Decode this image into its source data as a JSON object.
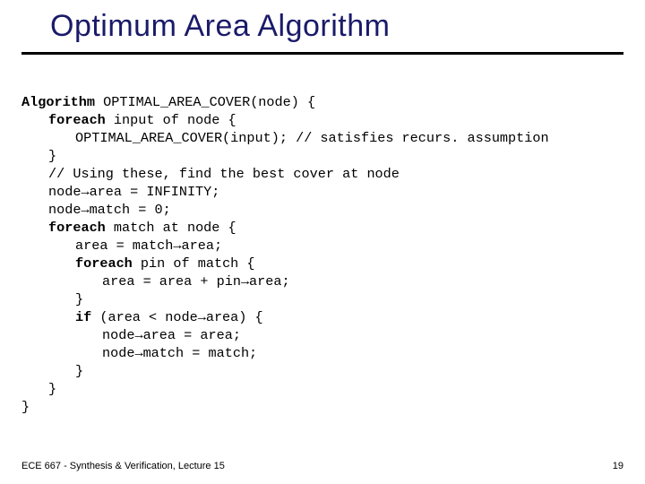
{
  "title": "Optimum Area Algorithm",
  "code": {
    "l1a": "Algorithm",
    "l1b": " OPTIMAL_AREA_COVER(node) {",
    "l2a": "foreach",
    "l2b": " input of node {",
    "l3": "OPTIMAL_AREA_COVER(input); // satisfies recurs. assumption",
    "l4": "}",
    "l5": "// Using these, find the best cover at node",
    "l6": "node→area = INFINITY;",
    "l7": "node→match = 0;",
    "l8a": "foreach",
    "l8b": " match at node {",
    "l9": "area = match→area;",
    "l10a": "foreach",
    "l10b": " pin of match {",
    "l11": "area = area + pin→area;",
    "l12": "}",
    "l13a": "if",
    "l13b": " (area < node→area) {",
    "l14": "node→area = area;",
    "l15": "node→match = match;",
    "l16": "}",
    "l17": "}",
    "l18": "}"
  },
  "footer": {
    "left": "ECE 667 - Synthesis & Verification, Lecture 15",
    "right": "19"
  }
}
